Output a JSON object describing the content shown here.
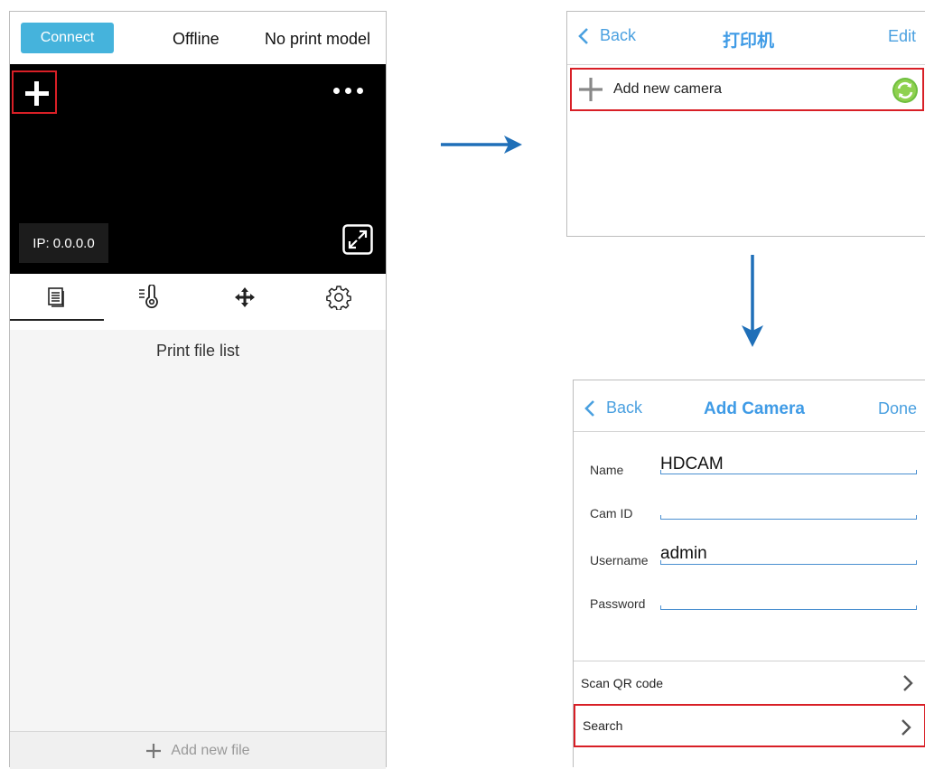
{
  "left_screen": {
    "connect_label": "Connect",
    "status": "Offline",
    "model": "No print model",
    "ip_label": "IP: 0.0.0.0",
    "tabs": [
      "file-list-icon",
      "temperature-icon",
      "move-icon",
      "gear-icon"
    ],
    "list_title": "Print file list",
    "add_file_label": "Add new file"
  },
  "printer_screen": {
    "back_label": "Back",
    "title": "打印机",
    "edit_label": "Edit",
    "add_camera_label": "Add new camera"
  },
  "add_camera_screen": {
    "back_label": "Back",
    "title": "Add Camera",
    "done_label": "Done",
    "fields": [
      {
        "label": "Name",
        "value": "HDCAM"
      },
      {
        "label": "Cam ID",
        "value": ""
      },
      {
        "label": "Username",
        "value": "admin"
      },
      {
        "label": "Password",
        "value": ""
      }
    ],
    "rows": [
      "Scan QR code",
      "Search"
    ]
  },
  "colors": {
    "accent_blue": "#45b3dc",
    "nav_blue": "#4aa0e0",
    "highlight_red": "#d81f26",
    "arrow_blue": "#1f6fb8"
  }
}
